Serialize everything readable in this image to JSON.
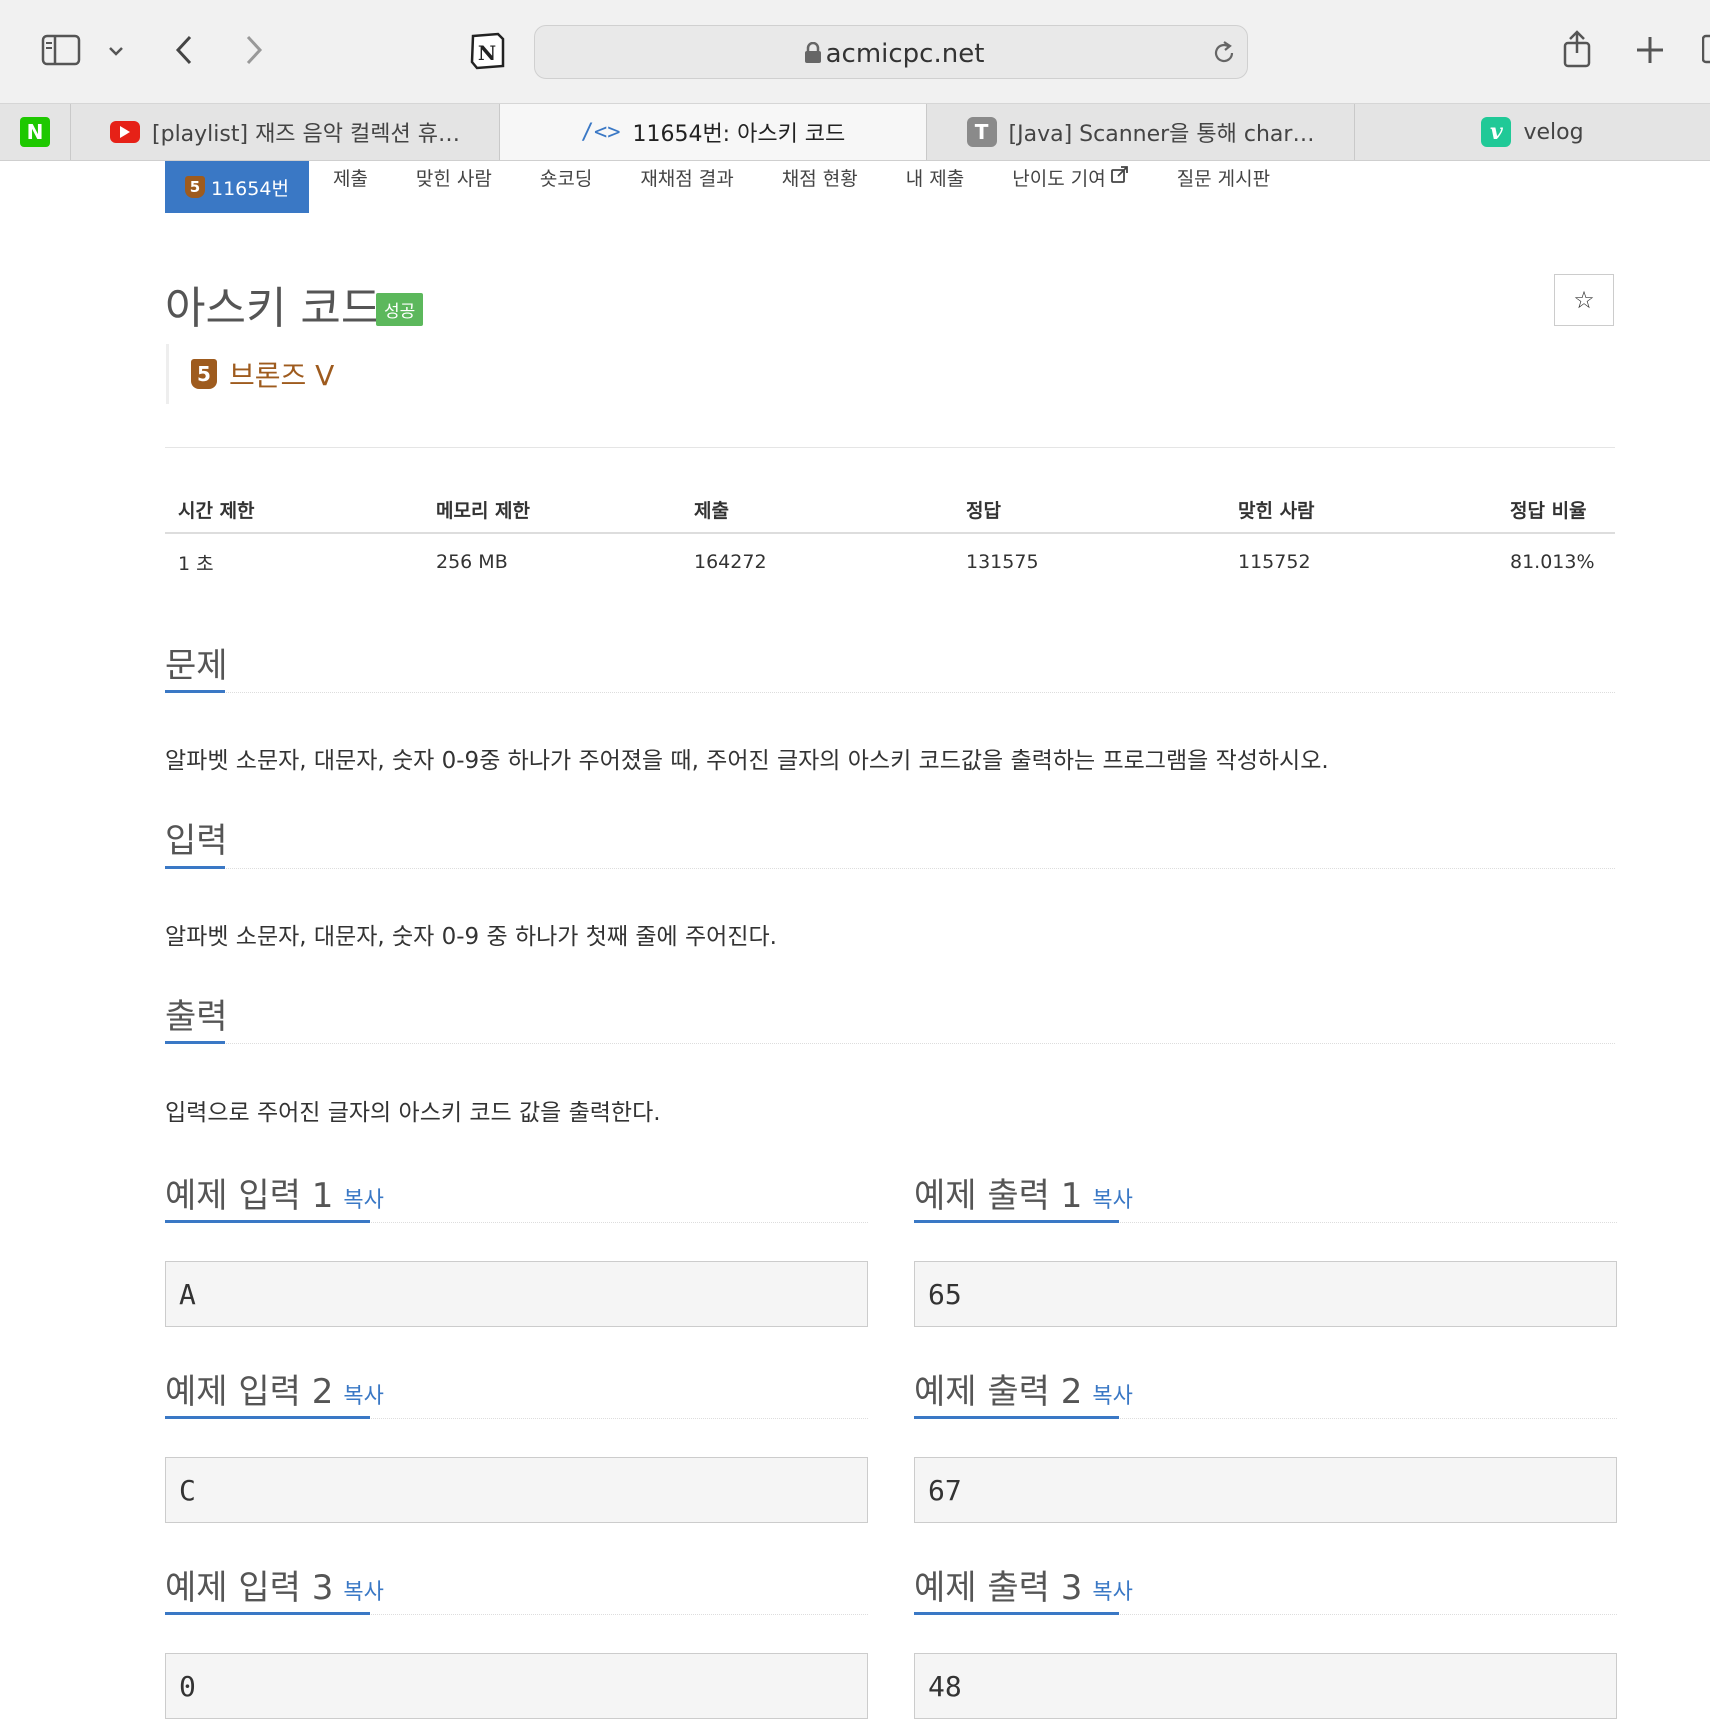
{
  "browser": {
    "url": "acmicpc.net",
    "tabs": [
      {
        "label": "[playlist] 재즈 음악 컬렉션 휴…",
        "icon": "youtube-icon"
      },
      {
        "label": "11654번: 아스키 코드",
        "icon": "code-icon"
      },
      {
        "label": "[Java] Scanner을 통해 char…",
        "icon": "tistory-icon",
        "icon_text": "T"
      },
      {
        "label": "velog",
        "icon": "velog-icon",
        "icon_text": "v"
      }
    ],
    "pinned_tab_icon_text": "N",
    "colors": {
      "youtube": "#e62117",
      "velog": "#20c997",
      "naver": "#1ec800",
      "tistory": "#8a8a8a"
    }
  },
  "subnav": {
    "problem": {
      "badge": "5",
      "label": "11654번"
    },
    "items": [
      "제출",
      "맞힌 사람",
      "숏코딩",
      "재채점 결과",
      "채점 현황",
      "내 제출",
      "난이도 기여",
      "질문 게시판"
    ]
  },
  "problem": {
    "title": "아스키 코드",
    "status_badge": "성공",
    "tier_badge": "5",
    "tier": "브론즈 V"
  },
  "info_table": {
    "headers": [
      "시간 제한",
      "메모리 제한",
      "제출",
      "정답",
      "맞힌 사람",
      "정답 비율"
    ],
    "row": [
      "1 초",
      "256 MB",
      "164272",
      "131575",
      "115752",
      "81.013%"
    ]
  },
  "sections": {
    "problem": {
      "title": "문제",
      "body": "알파벳 소문자, 대문자, 숫자 0-9중 하나가 주어졌을 때, 주어진 글자의 아스키 코드값을 출력하는 프로그램을 작성하시오."
    },
    "input": {
      "title": "입력",
      "body": "알파벳 소문자, 대문자, 숫자 0-9 중 하나가 첫째 줄에 주어진다."
    },
    "output": {
      "title": "출력",
      "body": "입력으로 주어진 글자의 아스키 코드 값을 출력한다."
    }
  },
  "samples": [
    {
      "input_title": "예제 입력 1",
      "output_title": "예제 출력 1",
      "input": "A",
      "output": "65"
    },
    {
      "input_title": "예제 입력 2",
      "output_title": "예제 출력 2",
      "input": "C",
      "output": "67"
    },
    {
      "input_title": "예제 입력 3",
      "output_title": "예제 출력 3",
      "input": "0",
      "output": "48"
    }
  ],
  "copy_label": "복사",
  "colors": {
    "accent": "#3a78c5",
    "success": "#5cb85c",
    "bronze": "#9e5b1e"
  }
}
